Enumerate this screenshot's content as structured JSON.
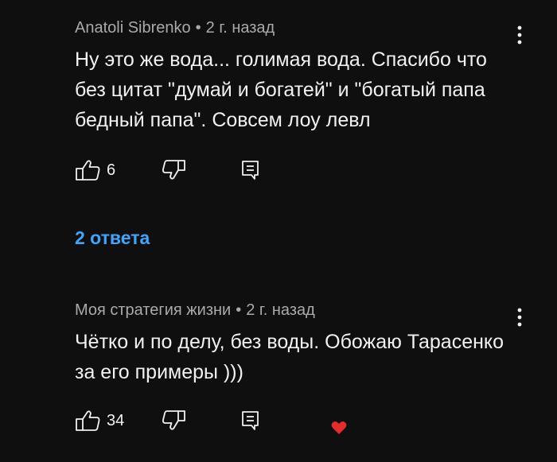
{
  "comments": [
    {
      "author": "Anatoli Sibrenko",
      "separator": "•",
      "time": "2 г. назад",
      "text": "Ну это же вода... голимая вода. Спасибо что без цитат \"думай и богатей\" и \"богатый папа бедный папа\". Совсем лоу левл",
      "likes": "6"
    },
    {
      "author": "Моя стратегия жизни",
      "separator": "•",
      "time": "2 г. назад",
      "text": "Чётко и по делу, без воды. Обожаю Тарасенко за его примеры )))",
      "likes": "34"
    }
  ],
  "replies_link": "2 ответа",
  "colors": {
    "background": "#0f0f0f",
    "text": "#f1f1f1",
    "meta": "#aaaaaa",
    "link": "#3ea6ff",
    "heart": "#e62b2b"
  },
  "icons": {
    "like": "thumbs-up-icon",
    "dislike": "thumbs-down-icon",
    "reply": "reply-icon",
    "more": "more-vertical-icon",
    "heart": "heart-icon"
  }
}
